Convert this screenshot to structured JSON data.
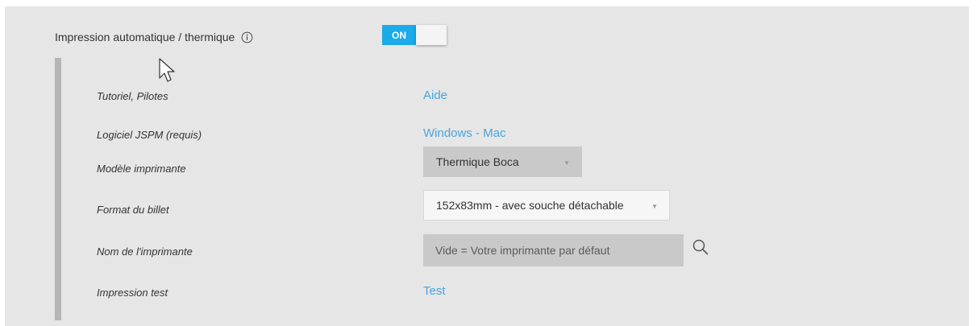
{
  "header": {
    "label": "Impression automatique / thermique",
    "info_icon": "info-circle-icon",
    "toggle_label": "ON",
    "toggle_state": "on"
  },
  "rows": {
    "tutorial": {
      "label": "Tutoriel, Pilotes",
      "link": "Aide"
    },
    "jspm": {
      "label": "Logiciel JSPM (requis)",
      "link_windows": "Windows",
      "separator": " - ",
      "link_mac": "Mac"
    },
    "model": {
      "label": "Modèle imprimante",
      "value": "Thermique Boca"
    },
    "format": {
      "label": "Format du billet",
      "value": "152x83mm - avec souche détachable"
    },
    "printer_name": {
      "label": "Nom de l'imprimante",
      "placeholder": "Vide = Votre imprimante par défaut",
      "value": ""
    },
    "test": {
      "label": "Impression test",
      "link": "Test"
    }
  },
  "colors": {
    "accent": "#1aabe8",
    "link": "#4aa4dd",
    "panel_bg": "#e6e6e6"
  }
}
